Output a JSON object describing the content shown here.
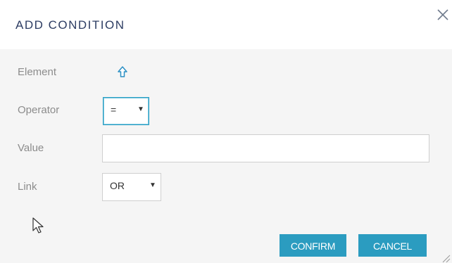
{
  "dialog": {
    "title": "ADD CONDITION",
    "close_icon": "close-icon"
  },
  "form": {
    "element": {
      "label": "Element",
      "icon": "arrow-up-icon"
    },
    "operator": {
      "label": "Operator",
      "selected": "="
    },
    "value": {
      "label": "Value",
      "current_value": "",
      "placeholder": ""
    },
    "link": {
      "label": "Link",
      "selected": "OR"
    }
  },
  "buttons": {
    "confirm_label": "CONFIRM",
    "cancel_label": "CANCEL"
  },
  "colors": {
    "accent": "#2b9cc0",
    "title": "#2d3d63",
    "label": "#8c8c8c",
    "body_background": "#f5f5f5"
  }
}
